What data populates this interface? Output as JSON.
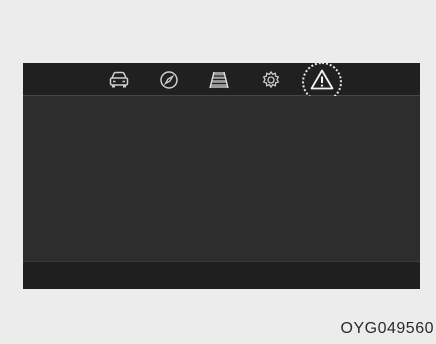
{
  "display": {
    "tabs": [
      {
        "icon": "car-icon",
        "active": false
      },
      {
        "icon": "compass-icon",
        "active": false
      },
      {
        "icon": "lane-road-icon",
        "active": false
      },
      {
        "icon": "gear-icon",
        "active": false
      },
      {
        "icon": "warning-triangle-icon",
        "active": true
      }
    ]
  },
  "figure_code": "OYG049560"
}
